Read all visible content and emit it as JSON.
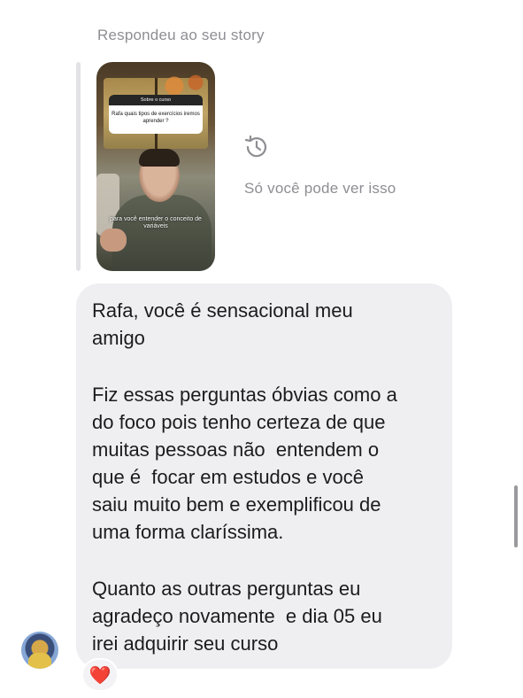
{
  "reply_label": "Respondeu ao seu story",
  "story": {
    "question_header": "Sobre o curso",
    "question_text": "Rafa quais tipos de exercícios iremos aprender ?",
    "caption": "para você entender o conceito de variáveis"
  },
  "private_note": "Só você pode ver isso",
  "message": {
    "lines": [
      "Rafa, você é sensacional meu",
      "amigo",
      "Fiz essas perguntas óbvias como a",
      "do foco pois tenho certeza de que",
      "muitas pessoas não  entendem o",
      "que é  focar em estudos e você",
      "saiu muito bem e exemplificou de",
      "uma forma claríssima.",
      "Quanto as outras perguntas eu",
      "agradeço novamente  e dia 05 eu",
      "irei adquirir seu curso"
    ]
  },
  "reaction": "❤️",
  "icons": {
    "history": "history-clock-icon",
    "reaction": "heart-icon"
  },
  "colors": {
    "secondary_text": "#8e8e93",
    "bubble_bg": "#efeff1",
    "heart": "#e0253b"
  }
}
